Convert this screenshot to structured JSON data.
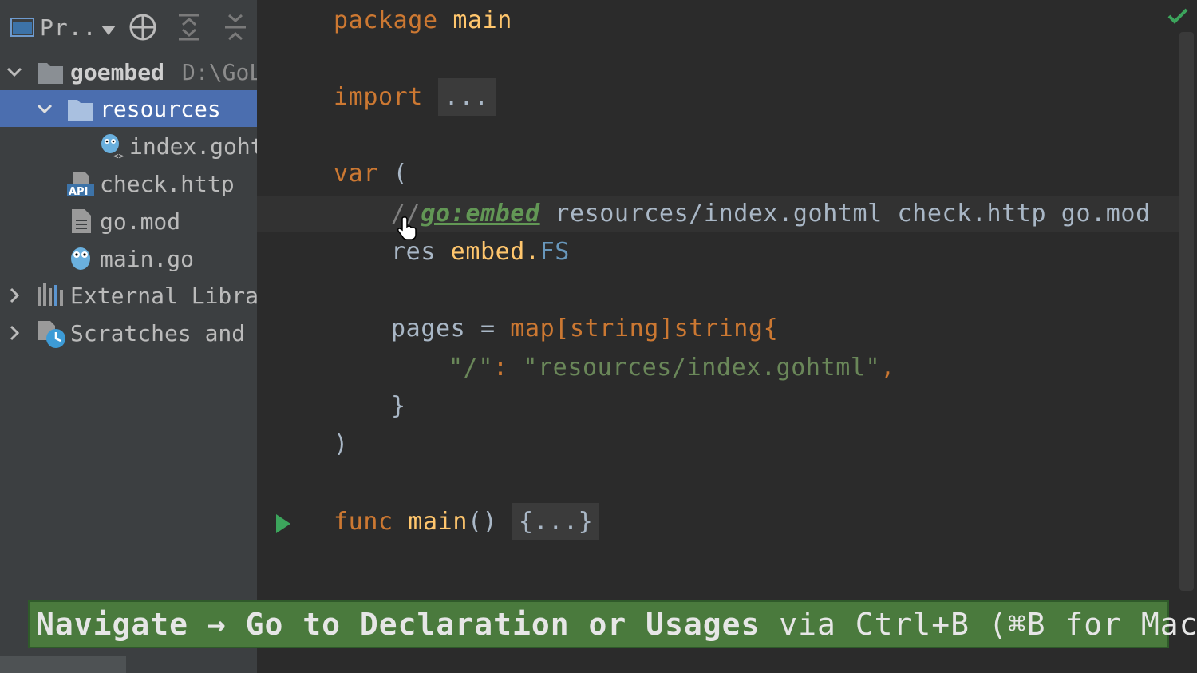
{
  "sidebar": {
    "project_selector": "Pr..",
    "tree": [
      {
        "label": "goembed",
        "path": "D:\\GoL",
        "level": 0,
        "expanded": true
      },
      {
        "label": "resources",
        "level": 1,
        "expanded": true,
        "selected": true
      },
      {
        "label": "index.goht",
        "level": 2
      },
      {
        "label": "check.http",
        "level": 1
      },
      {
        "label": "go.mod",
        "level": 1
      },
      {
        "label": "main.go",
        "level": 1
      },
      {
        "label": "External Libra",
        "level": 0,
        "expanded": false
      },
      {
        "label": "Scratches and",
        "level": 0,
        "expanded": false
      }
    ]
  },
  "editor": {
    "line_package_kw": "package",
    "line_package_name": "main",
    "line_import_kw": "import",
    "line_import_fold": "...",
    "line_var_kw": "var",
    "line_var_paren": "(",
    "line_embed_comment": "//",
    "line_embed_directive": "go:embed",
    "line_embed_files": " resources/index.gohtml check.http go.mod",
    "line_res_name": "res ",
    "line_res_pkg": "embed.",
    "line_res_type": "FS",
    "line_pages_name": "pages = ",
    "line_pages_map": "map",
    "line_pages_b1": "[",
    "line_pages_k": "string",
    "line_pages_b2": "]",
    "line_pages_v": "string",
    "line_pages_brace": "{",
    "line_entry_key": "\"/\"",
    "line_entry_colon": ": ",
    "line_entry_value": "\"resources/index.gohtml\"",
    "line_entry_comma": ",",
    "line_close_brace": "}",
    "line_close_paren": ")",
    "line_func_kw": "func",
    "line_func_name": "main",
    "line_func_parens": "() ",
    "line_func_fold": "{...}"
  },
  "tip": {
    "part1": "Navigate → Go to Declaration or Usages",
    "part2": " via Ctrl+B (⌘B for Mac)"
  },
  "colors": {
    "keyword": "#cc7832",
    "string": "#6a8759",
    "selection": "#4b6eaf",
    "banner": "#4a7a3d"
  }
}
